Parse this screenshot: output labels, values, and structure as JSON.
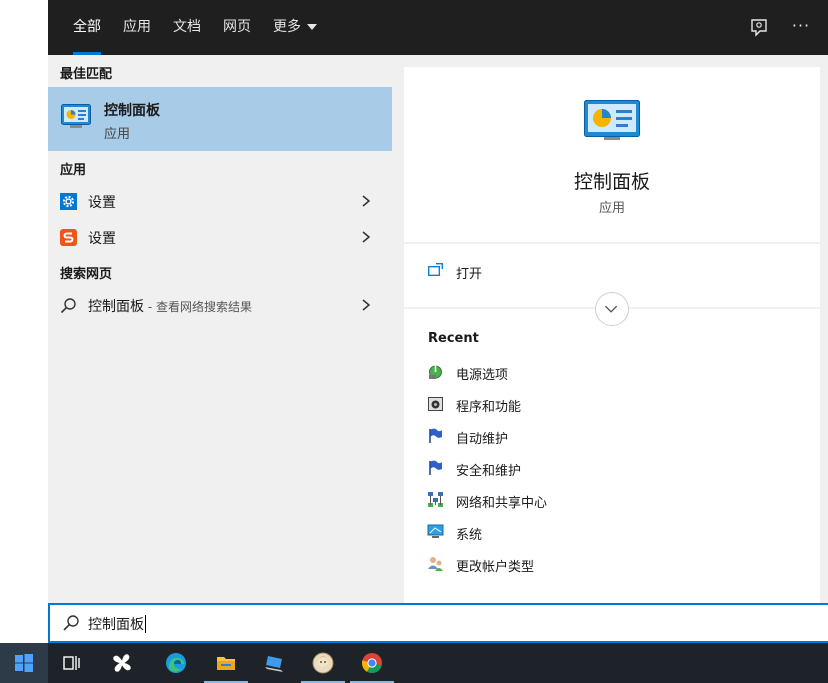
{
  "tabs": [
    {
      "label": "全部"
    },
    {
      "label": "应用"
    },
    {
      "label": "文档"
    },
    {
      "label": "网页"
    },
    {
      "label": "更多"
    }
  ],
  "left": {
    "best_match_title": "最佳匹配",
    "best_match": {
      "title": "控制面板",
      "subtitle": "应用"
    },
    "apps_title": "应用",
    "apps": [
      {
        "label": "设置",
        "icon": "settings-gear-icon"
      },
      {
        "label": "设置",
        "icon": "sogou-settings-icon"
      }
    ],
    "web_title": "搜索网页",
    "web_result": {
      "label": "控制面板",
      "suffix": " - 查看网络搜索结果"
    }
  },
  "preview": {
    "title": "控制面板",
    "subtitle": "应用",
    "open_label": "打开",
    "recent_title": "Recent",
    "recent": [
      {
        "label": "电源选项",
        "icon": "power-options-icon"
      },
      {
        "label": "程序和功能",
        "icon": "programs-features-icon"
      },
      {
        "label": "自动维护",
        "icon": "flag-icon"
      },
      {
        "label": "安全和维护",
        "icon": "flag-icon"
      },
      {
        "label": "网络和共享中心",
        "icon": "network-icon"
      },
      {
        "label": "系统",
        "icon": "system-icon"
      },
      {
        "label": "更改帐户类型",
        "icon": "users-icon"
      }
    ]
  },
  "search": {
    "value": "控制面板"
  },
  "taskbar": {
    "items": [
      "start-icon",
      "task-view-icon",
      "pinwheel-app-icon",
      "edge-icon",
      "file-explorer-icon",
      "laptop-app-icon",
      "avatar-app-icon",
      "chrome-icon"
    ]
  },
  "colors": {
    "accent": "#0078d4",
    "selected": "#a8cbe8",
    "topbar": "#1f1f1f",
    "taskbar": "#1e2329"
  }
}
